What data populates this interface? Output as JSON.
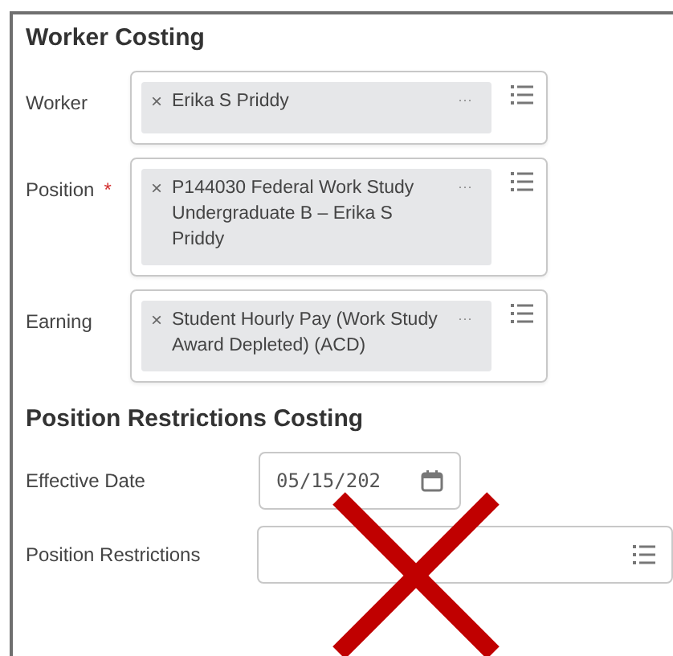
{
  "worker_costing": {
    "title": "Worker Costing",
    "fields": [
      {
        "label": "Worker",
        "value": "Erika S Priddy",
        "remove": "×",
        "more": "···"
      },
      {
        "label": "Position",
        "required_mark": "*",
        "value": "P144030 Federal Work Study Undergraduate  B – Erika S Priddy",
        "remove": "×",
        "more": "···"
      },
      {
        "label": "Earning",
        "value": "Student Hourly Pay (Work Study Award Depleted) (ACD)",
        "remove": "×",
        "more": "···"
      }
    ]
  },
  "position_restrictions_costing": {
    "title": "Position Restrictions Costing",
    "fields": [
      {
        "kind": "date",
        "label": "Effective Date",
        "value": "05/15/202"
      },
      {
        "kind": "prompt",
        "label": "Position Restrictions"
      }
    ]
  }
}
